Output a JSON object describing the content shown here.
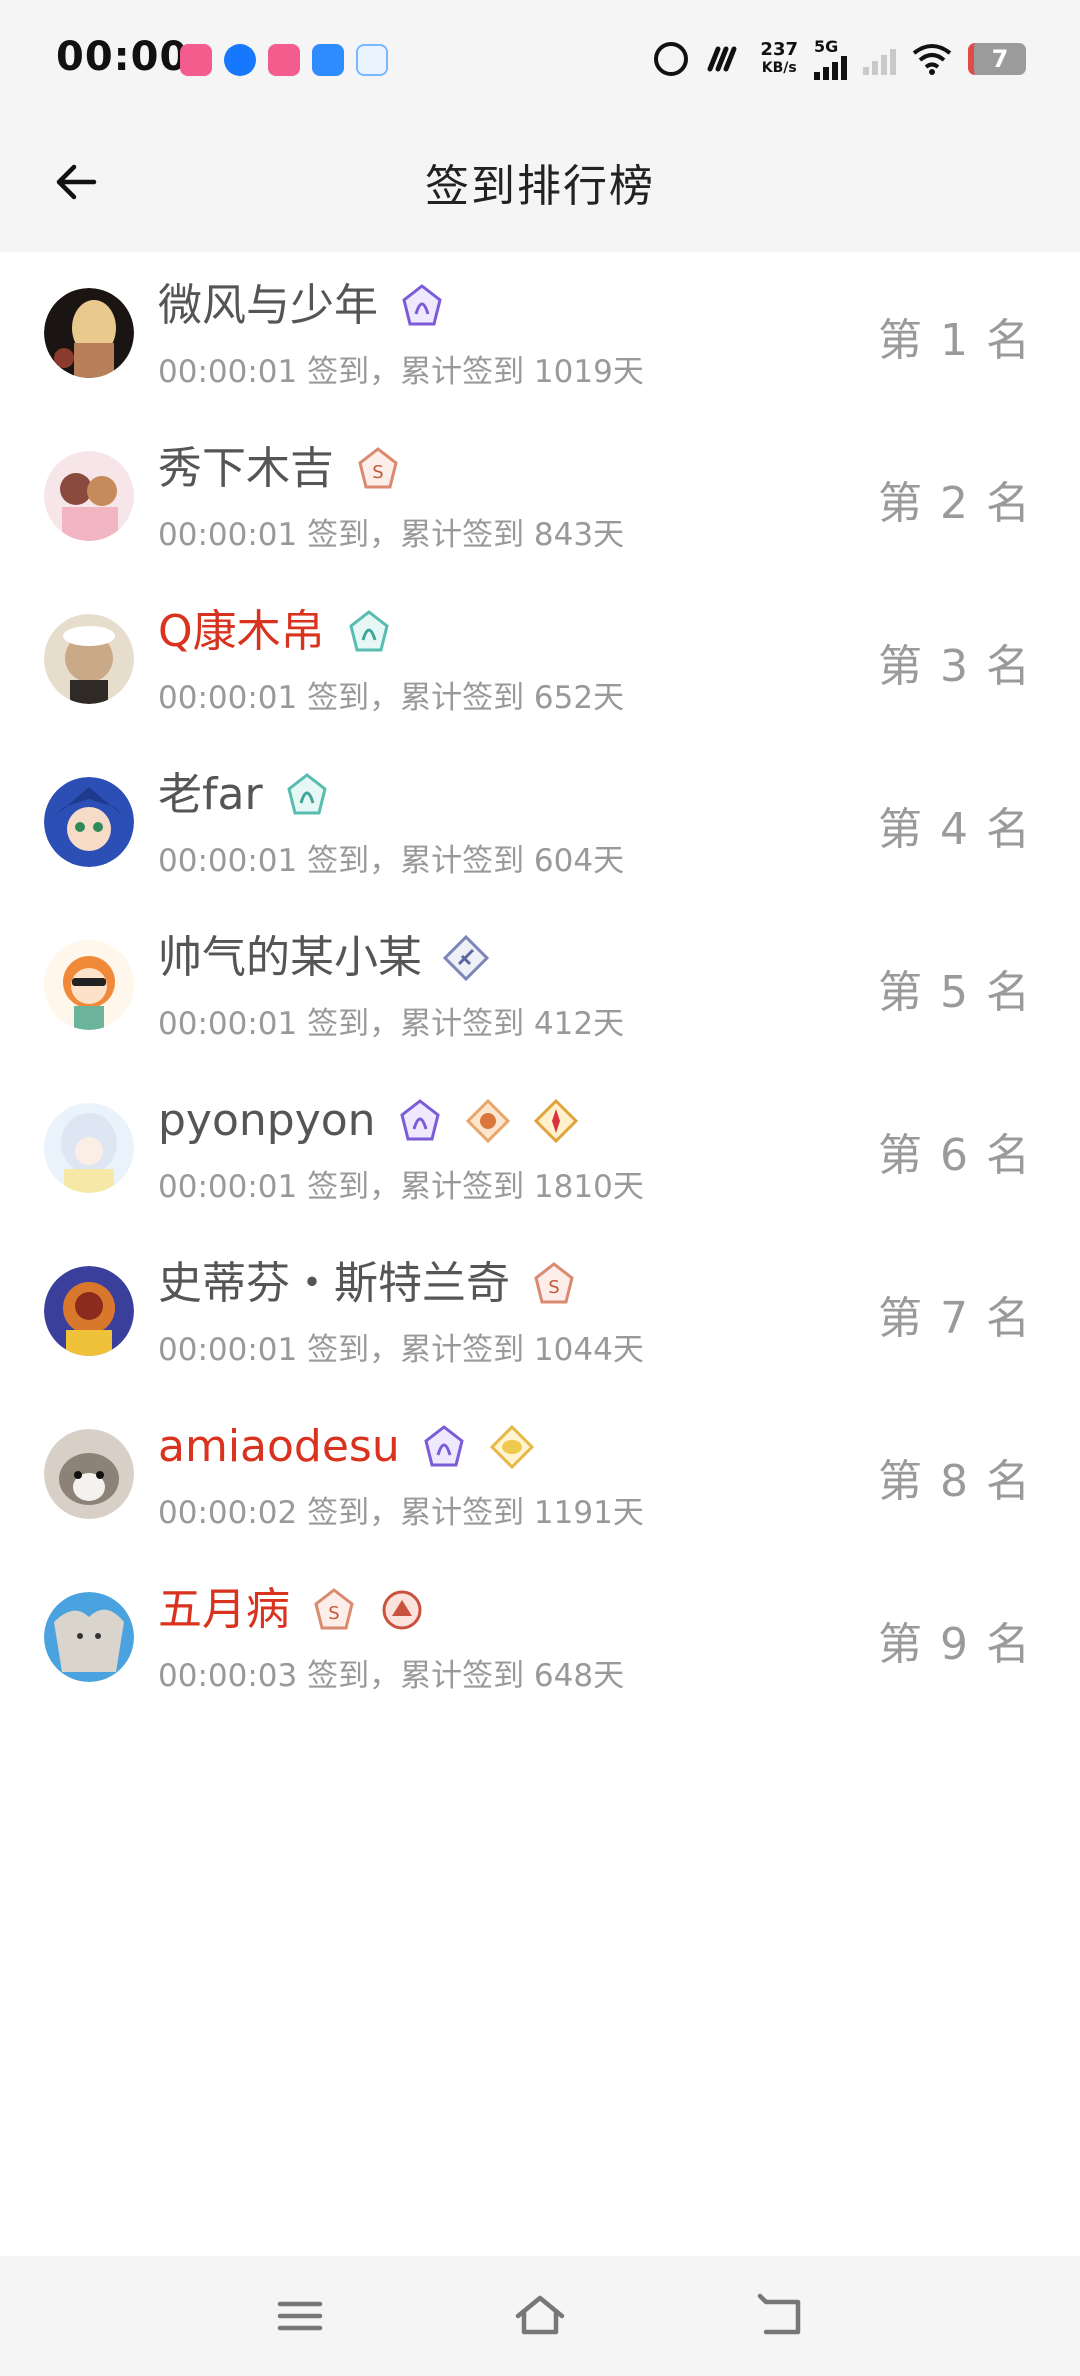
{
  "status_bar": {
    "time": "00:00",
    "speed_value": "237",
    "speed_unit": "KB/s",
    "network": "5G",
    "battery": "7"
  },
  "header": {
    "title": "签到排行榜"
  },
  "rows": [
    {
      "name": "微风与少年",
      "meta": "00:00:01 签到，累计签到 1019天",
      "rank": "第 1 名",
      "name_color": "gray"
    },
    {
      "name": "秀下木吉",
      "meta": "00:00:01 签到，累计签到 843天",
      "rank": "第 2 名",
      "name_color": "gray"
    },
    {
      "name": "Q康木帛",
      "meta": "00:00:01 签到，累计签到 652天",
      "rank": "第 3 名",
      "name_color": "red"
    },
    {
      "name": "老far",
      "meta": "00:00:01 签到，累计签到 604天",
      "rank": "第 4 名",
      "name_color": "gray"
    },
    {
      "name": "帅气的某小某",
      "meta": "00:00:01 签到，累计签到 412天",
      "rank": "第 5 名",
      "name_color": "gray"
    },
    {
      "name": "pyonpyon",
      "meta": "00:00:01 签到，累计签到 1810天",
      "rank": "第 6 名",
      "name_color": "gray"
    },
    {
      "name": "史蒂芬・斯特兰奇",
      "meta": "00:00:01 签到，累计签到 1044天",
      "rank": "第 7 名",
      "name_color": "gray"
    },
    {
      "name": "amiaodesu",
      "meta": "00:00:02 签到，累计签到 1191天",
      "rank": "第 8 名",
      "name_color": "red"
    },
    {
      "name": "五月病",
      "meta": "00:00:03 签到，累计签到 648天",
      "rank": "第 9 名",
      "name_color": "red"
    }
  ],
  "colors": {
    "name_red": "#d9331f",
    "name_gray": "#555555",
    "meta_gray": "#999999",
    "header_bg": "#f5f5f5"
  },
  "icons": {
    "back": "arrow-left-icon",
    "nav_menu": "menu-icon",
    "nav_home": "home-icon",
    "nav_back": "return-icon"
  }
}
